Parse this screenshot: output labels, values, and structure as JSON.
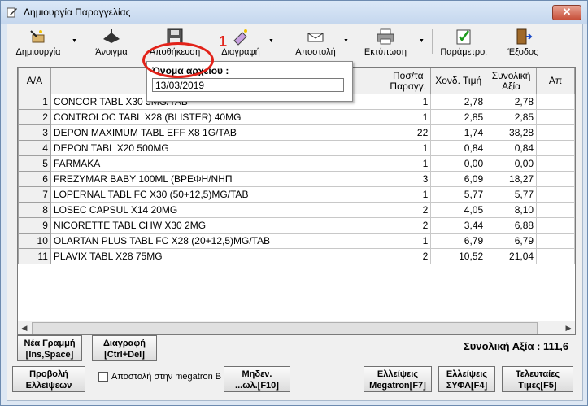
{
  "window": {
    "title": "Δημιουργία Παραγγελίας",
    "close_glyph": "✕"
  },
  "toolbar": {
    "create": "Δημιουργία",
    "open": "Άνοιγμα",
    "save": "Αποθήκευση",
    "delete": "Διαγραφή",
    "send": "Αποστολή",
    "print": "Εκτύπωση",
    "params": "Παράμετροι",
    "exit": "Έξοδος"
  },
  "save_popup": {
    "label": "Όνομα αρχείου :",
    "value": "13/03/2019"
  },
  "annotation": {
    "number": "1"
  },
  "table": {
    "headers": [
      "Α/Α",
      "",
      "Ποσ/τα Παραγγ.",
      "Χονδ. Τιμή",
      "Συνολική Αξία",
      "Απ"
    ],
    "rows": [
      [
        "1",
        "CONCOR TABL X30 5MG/TAB",
        "1",
        "2,78",
        "2,78"
      ],
      [
        "2",
        "CONTROLOC TABL X28 (BLISTER) 40MG",
        "1",
        "2,85",
        "2,85"
      ],
      [
        "3",
        "DEPON MAXIMUM TABL EFF X8 1G/TAB",
        "22",
        "1,74",
        "38,28"
      ],
      [
        "4",
        "DEPON TABL X20 500MG",
        "1",
        "0,84",
        "0,84"
      ],
      [
        "5",
        "FARMAKA",
        "1",
        "0,00",
        "0,00"
      ],
      [
        "6",
        "FREZYMAR BABY 100ML (ΒΡΕΦΗ/ΝΗΠ",
        "3",
        "6,09",
        "18,27"
      ],
      [
        "7",
        "LOPERNAL TABL FC X30 (50+12,5)MG/TAB",
        "1",
        "5,77",
        "5,77"
      ],
      [
        "8",
        "LOSEC CAPSUL X14 20MG",
        "2",
        "4,05",
        "8,10"
      ],
      [
        "9",
        "NICORETTE TABL CHW X30 2MG",
        "2",
        "3,44",
        "6,88"
      ],
      [
        "10",
        "OLARTAN PLUS TABL FC X28 (20+12,5)MG/TAB",
        "1",
        "6,79",
        "6,79"
      ],
      [
        "11",
        "PLAVIX TABL X28 75MG",
        "2",
        "10,52",
        "21,04"
      ]
    ]
  },
  "buttons": {
    "new_row_1": "Νέα Γραμμή",
    "new_row_2": "[Ins,Space]",
    "delete_row_1": "Διαγραφή",
    "delete_row_2": "[Ctrl+Del]",
    "show_missing_1": "Προβολή",
    "show_missing_2": "Ελλείψεων",
    "zero_1": "Μηδεν.",
    "zero_2": "...ωλ.[F10]",
    "megatron_1": "Ελλείψεις",
    "megatron_2": "Megatron[F7]",
    "syfa_1": "Ελλείψεις",
    "syfa_2": "ΣΥΦΑ[F4]",
    "last_prices_1": "Τελευταίες",
    "last_prices_2": "Τιμές[F5]"
  },
  "send_megatron_checkbox": "Αποστολή στην megatron B",
  "total": "Συνολική Αξία : 111,6"
}
